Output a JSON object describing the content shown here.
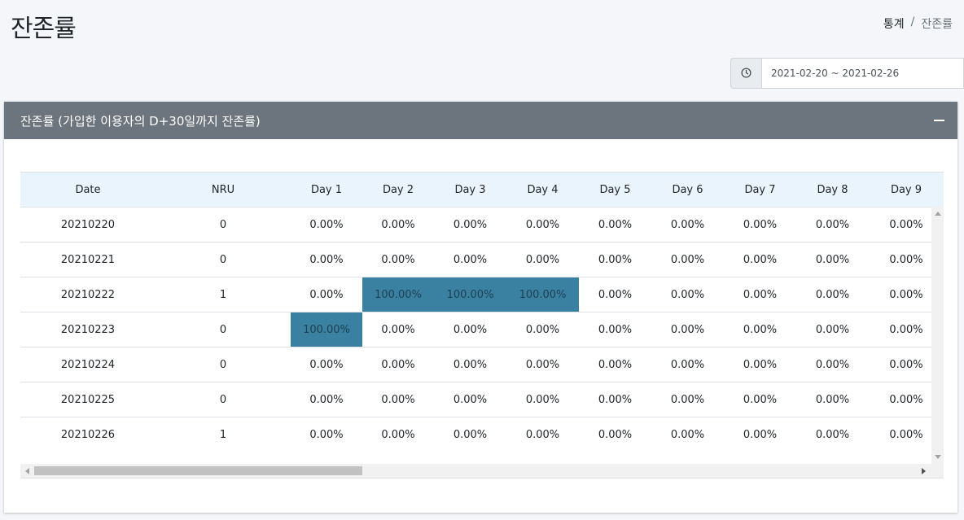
{
  "page": {
    "title": "잔존률"
  },
  "breadcrumb": {
    "parent": "통계",
    "separator": "/",
    "current": "잔존률"
  },
  "date_range": {
    "value": "2021-02-20 ~ 2021-02-26",
    "icon": "clock-icon"
  },
  "card": {
    "title": "잔존률 (가입한 이용자의 D+30일까지 잔존률)",
    "collapse_icon": "minus-icon"
  },
  "table": {
    "highlight_color": "#3a80a0",
    "header_color": "#eaf4fd",
    "columns": [
      "Date",
      "NRU",
      "Day 1",
      "Day 2",
      "Day 3",
      "Day 4",
      "Day 5",
      "Day 6",
      "Day 7",
      "Day 8",
      "Day 9"
    ],
    "rows": [
      {
        "cells": [
          "20210220",
          "0",
          "0.00%",
          "0.00%",
          "0.00%",
          "0.00%",
          "0.00%",
          "0.00%",
          "0.00%",
          "0.00%",
          "0.00%"
        ],
        "highlight": []
      },
      {
        "cells": [
          "20210221",
          "0",
          "0.00%",
          "0.00%",
          "0.00%",
          "0.00%",
          "0.00%",
          "0.00%",
          "0.00%",
          "0.00%",
          "0.00%"
        ],
        "highlight": []
      },
      {
        "cells": [
          "20210222",
          "1",
          "0.00%",
          "100.00%",
          "100.00%",
          "100.00%",
          "0.00%",
          "0.00%",
          "0.00%",
          "0.00%",
          "0.00%"
        ],
        "highlight": [
          3,
          4,
          5
        ]
      },
      {
        "cells": [
          "20210223",
          "0",
          "100.00%",
          "0.00%",
          "0.00%",
          "0.00%",
          "0.00%",
          "0.00%",
          "0.00%",
          "0.00%",
          "0.00%"
        ],
        "highlight": [
          2
        ]
      },
      {
        "cells": [
          "20210224",
          "0",
          "0.00%",
          "0.00%",
          "0.00%",
          "0.00%",
          "0.00%",
          "0.00%",
          "0.00%",
          "0.00%",
          "0.00%"
        ],
        "highlight": []
      },
      {
        "cells": [
          "20210225",
          "0",
          "0.00%",
          "0.00%",
          "0.00%",
          "0.00%",
          "0.00%",
          "0.00%",
          "0.00%",
          "0.00%",
          "0.00%"
        ],
        "highlight": []
      },
      {
        "cells": [
          "20210226",
          "1",
          "0.00%",
          "0.00%",
          "0.00%",
          "0.00%",
          "0.00%",
          "0.00%",
          "0.00%",
          "0.00%",
          "0.00%"
        ],
        "highlight": []
      }
    ]
  }
}
